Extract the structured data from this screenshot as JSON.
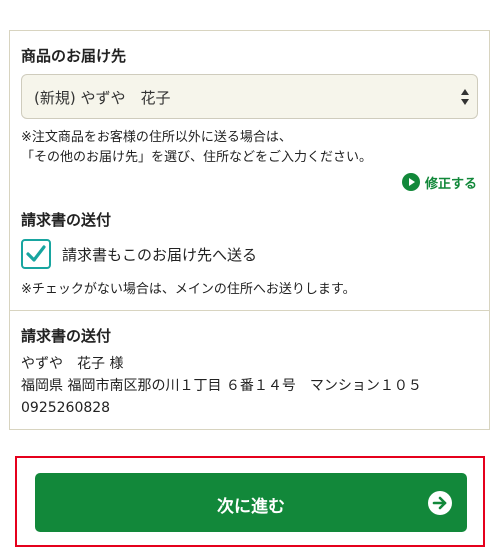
{
  "delivery": {
    "heading": "商品のお届け先",
    "selected": "(新規) やずや　花子",
    "note_line1": "※注文商品をお客様の住所以外に送る場合は、",
    "note_line2": "「その他のお届け先」を選び、住所などをご入力ください。",
    "edit_label": "修正する"
  },
  "invoice": {
    "heading": "請求書の送付",
    "checkbox_label": "請求書もこのお届け先へ送る",
    "checked": true,
    "note": "※チェックがない場合は、メインの住所へお送りします。"
  },
  "invoice_address": {
    "heading": "請求書の送付",
    "name": "やずや　花子 様",
    "address": "福岡県 福岡市南区那の川１丁目 ６番１４号　マンション１０５",
    "phone": "0925260828"
  },
  "next_button": {
    "label": "次に進む"
  },
  "colors": {
    "accent_green": "#12883a",
    "checkbox_teal": "#18a5a0",
    "highlight_red": "#e5001c"
  }
}
